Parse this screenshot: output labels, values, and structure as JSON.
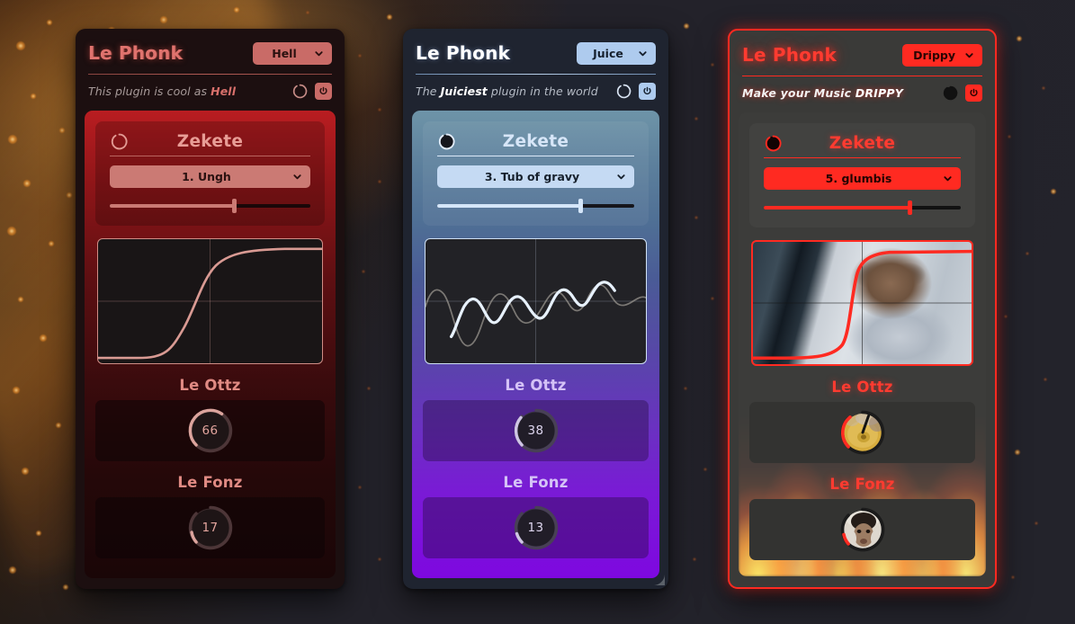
{
  "desktop": {
    "background_color": "#24242c",
    "accent_ember": "#ff9a28"
  },
  "panels": [
    {
      "id": "hell",
      "brand": "Le Phonk",
      "preset": {
        "label": "Hell",
        "icon": "chevron-down-icon"
      },
      "tagline_prefix": "This plugin is cool as ",
      "tagline_accent": "Hell",
      "tagline_suffix": "",
      "header_knob": "knob-icon",
      "power": "power-icon",
      "module": {
        "title": "Zekete",
        "knob_icon": "knob-icon",
        "combo": {
          "label": "1. Ungh",
          "icon": "chevron-down-icon"
        },
        "slider": {
          "value": 62,
          "min": 0,
          "max": 100
        },
        "curve_type": "sigmoid"
      },
      "knobs": [
        {
          "label": "Le Ottz",
          "value": "66",
          "pct": 66
        },
        {
          "label": "Le Fonz",
          "value": "17",
          "pct": 17
        }
      ],
      "colors": {
        "accent": "#c96b67",
        "curve": "#d99a93",
        "body_top": "#b91d21",
        "body_bottom": "#1a0607"
      }
    },
    {
      "id": "juice",
      "brand": "Le Phonk",
      "preset": {
        "label": "Juice",
        "icon": "chevron-down-icon"
      },
      "tagline_prefix": "The ",
      "tagline_accent": "Juiciest",
      "tagline_suffix": " plugin in the world",
      "header_knob": "knob-icon",
      "power": "power-icon",
      "module": {
        "title": "Zekete",
        "knob_icon": "knob-icon",
        "combo": {
          "label": "3. Tub of gravy",
          "icon": "chevron-down-icon"
        },
        "slider": {
          "value": 73,
          "min": 0,
          "max": 100
        },
        "curve_type": "wave"
      },
      "knobs": [
        {
          "label": "Le Ottz",
          "value": "38",
          "pct": 38
        },
        {
          "label": "Le Fonz",
          "value": "13",
          "pct": 13
        }
      ],
      "colors": {
        "accent": "#aecbee",
        "curve": "#dceafb",
        "body_top": "#6e94a8",
        "body_bottom": "#7e08e0"
      }
    },
    {
      "id": "drippy",
      "brand": "Le Phonk",
      "preset": {
        "label": "Drippy",
        "icon": "chevron-down-icon"
      },
      "tagline_prefix": "Make your Music ",
      "tagline_accent": "DRIPPY",
      "tagline_suffix": "",
      "header_knob": "knob-icon",
      "power": "power-icon",
      "module": {
        "title": "Zekete",
        "knob_icon": "knob-icon",
        "combo": {
          "label": "5. glumbis",
          "icon": "chevron-down-icon"
        },
        "slider": {
          "value": 74,
          "min": 0,
          "max": 100
        },
        "curve_type": "sigmoid-steep"
      },
      "knobs": [
        {
          "label": "Le Ottz",
          "value": "",
          "pct": 72,
          "skin": "cymbal-image-knob"
        },
        {
          "label": "Le Fonz",
          "value": "",
          "pct": 18,
          "skin": "face-image-knob"
        }
      ],
      "colors": {
        "accent": "#ff2a21",
        "curve": "#ff2a21",
        "body": "#3c3c3a",
        "fire": "#ff9010"
      }
    }
  ]
}
